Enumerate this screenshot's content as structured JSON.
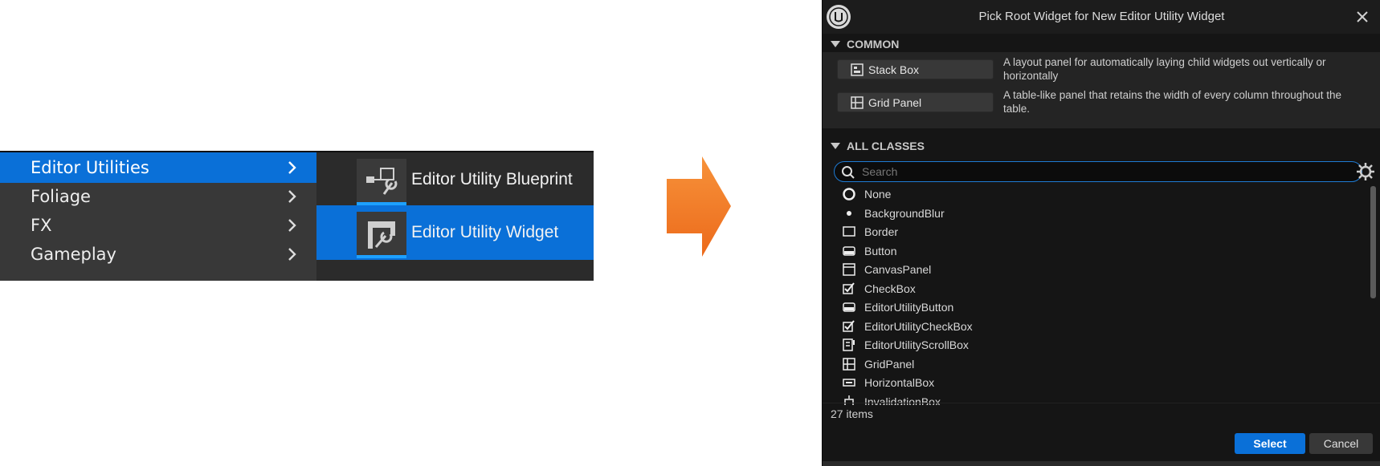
{
  "context_menu": {
    "items": [
      {
        "label": "Editor Utilities",
        "selected": true
      },
      {
        "label": "Foliage",
        "selected": false
      },
      {
        "label": "FX",
        "selected": false
      },
      {
        "label": "Gameplay",
        "selected": false
      }
    ],
    "submenu": [
      {
        "label": "Editor Utility Blueprint",
        "icon": "editor-utility-blueprint-icon",
        "selected": false
      },
      {
        "label": "Editor Utility Widget",
        "icon": "editor-utility-widget-icon",
        "selected": true
      }
    ],
    "highlight_color": "#0a70d8"
  },
  "arrow": {
    "color": "#f07a26"
  },
  "dialog": {
    "title": "Pick Root Widget for New Editor Utility Widget",
    "common": {
      "header": "COMMON",
      "items": [
        {
          "label": "Stack Box",
          "description": "A layout panel for automatically laying child widgets out vertically or horizontally"
        },
        {
          "label": "Grid Panel",
          "description": "A table-like panel that retains the width of every column throughout the table."
        }
      ]
    },
    "all_classes": {
      "header": "ALL CLASSES",
      "search_placeholder": "Search",
      "items": [
        {
          "label": "None",
          "icon": "ring-icon"
        },
        {
          "label": "BackgroundBlur",
          "icon": "dot-icon"
        },
        {
          "label": "Border",
          "icon": "border-icon"
        },
        {
          "label": "Button",
          "icon": "button-icon"
        },
        {
          "label": "CanvasPanel",
          "icon": "canvas-panel-icon"
        },
        {
          "label": "CheckBox",
          "icon": "checkbox-icon"
        },
        {
          "label": "EditorUtilityButton",
          "icon": "button-icon"
        },
        {
          "label": "EditorUtilityCheckBox",
          "icon": "checkbox-icon"
        },
        {
          "label": "EditorUtilityScrollBox",
          "icon": "scroll-box-icon"
        },
        {
          "label": "GridPanel",
          "icon": "grid-panel-icon"
        },
        {
          "label": "HorizontalBox",
          "icon": "horizontal-box-icon"
        },
        {
          "label": "InvalidationBox",
          "icon": "invalidation-box-icon"
        }
      ],
      "count_label": "27 items"
    },
    "buttons": {
      "select": "Select",
      "cancel": "Cancel"
    },
    "accent_color": "#0a70d8"
  }
}
